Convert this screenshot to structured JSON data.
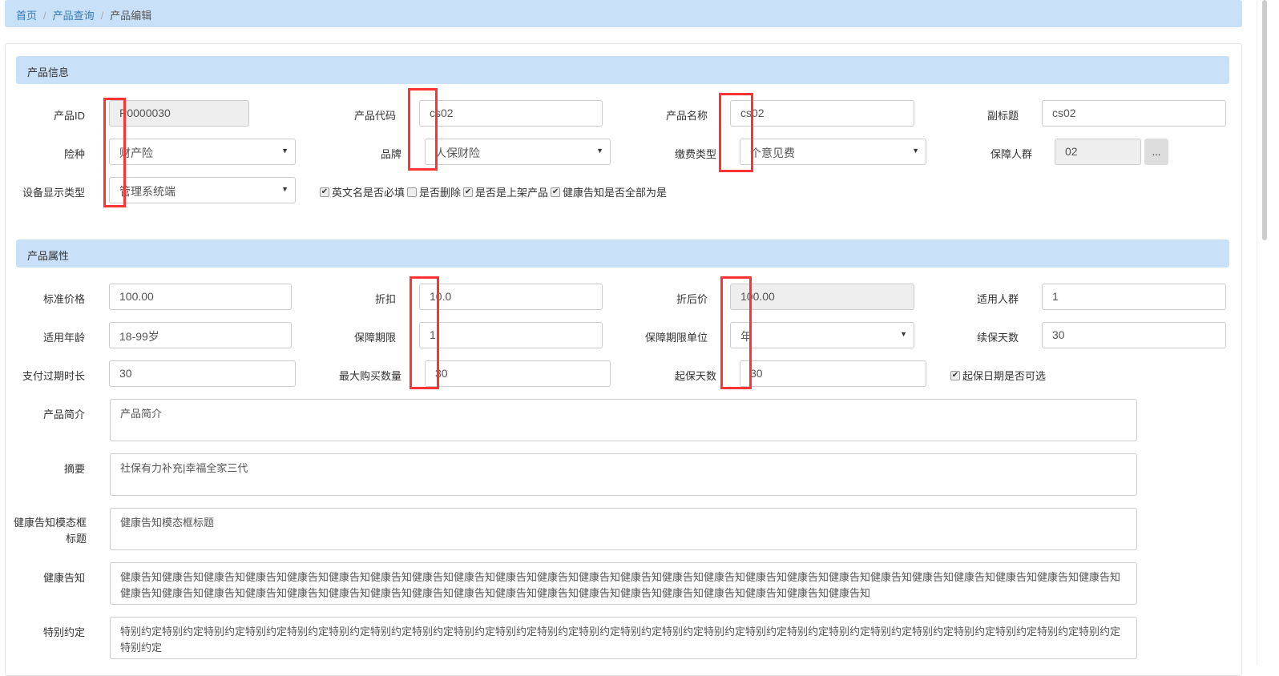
{
  "breadcrumb": [
    "首页",
    "产品查询",
    "产品编辑"
  ],
  "sections": {
    "info": "产品信息",
    "attrs": "产品属性"
  },
  "info": {
    "product_id": {
      "label": "产品ID",
      "value": "P0000030"
    },
    "product_code": {
      "label": "产品代码",
      "value": "cs02"
    },
    "product_name": {
      "label": "产品名称",
      "value": "cs02"
    },
    "subtitle": {
      "label": "副标题",
      "value": "cs02"
    },
    "insurance_type": {
      "label": "险种",
      "value": "财产险"
    },
    "brand": {
      "label": "品牌",
      "value": "人保财险"
    },
    "fee_type": {
      "label": "缴费类型",
      "value": "个意见费"
    },
    "insured_group": {
      "label": "保障人群",
      "value": "02",
      "button": "..."
    },
    "device_type": {
      "label": "设备显示类型",
      "value": "管理系统端"
    },
    "checkboxes": [
      {
        "label": "英文名是否必填",
        "checked": true
      },
      {
        "label": "是否删除",
        "checked": false
      },
      {
        "label": "是否是上架产品",
        "checked": true
      },
      {
        "label": "健康告知是否全部为是",
        "checked": true
      }
    ]
  },
  "attrs": {
    "std_price": {
      "label": "标准价格",
      "value": "100.00"
    },
    "discount": {
      "label": "折扣",
      "value": "10.0"
    },
    "discounted_price": {
      "label": "折后价",
      "value": "100.00"
    },
    "applicable_group": {
      "label": "适用人群",
      "value": "1"
    },
    "age": {
      "label": "适用年龄",
      "value": "18-99岁"
    },
    "period": {
      "label": "保障期限",
      "value": "1"
    },
    "period_unit": {
      "label": "保障期限单位",
      "value": "年"
    },
    "renew_days": {
      "label": "续保天数",
      "value": "30"
    },
    "pay_expire": {
      "label": "支付过期时长",
      "value": "30"
    },
    "max_qty": {
      "label": "最大购买数量",
      "value": "30"
    },
    "start_days": {
      "label": "起保天数",
      "value": "30"
    },
    "start_date_optional": {
      "label": "起保日期是否可选",
      "checked": true
    },
    "intro": {
      "label": "产品简介",
      "value": "产品简介"
    },
    "summary": {
      "label": "摘要",
      "value": "社保有力补充|幸福全家三代"
    },
    "health_title": {
      "label": "健康告知模态框标题",
      "value": "健康告知模态框标题"
    },
    "health": {
      "label": "健康告知",
      "value": "健康告知健康告知健康告知健康告知健康告知健康告知健康告知健康告知健康告知健康告知健康告知健康告知健康告知健康告知健康告知健康告知健康告知健康告知健康告知健康告知健康告知健康告知健康告知健康告知健康告知健康告知健康告知健康告知健康告知健康告知健康告知健康告知健康告知健康告知健康告知健康告知健康告知健康告知健康告知健康告知健康告知健康告知"
    },
    "special": {
      "label": "特别约定",
      "value": "特别约定特别约定特别约定特别约定特别约定特别约定特别约定特别约定特别约定特别约定特别约定特别约定特别约定特别约定特别约定特别约定特别约定特别约定特别约定特别约定特别约定特别约定特别约定特别约定特别约定"
    }
  }
}
